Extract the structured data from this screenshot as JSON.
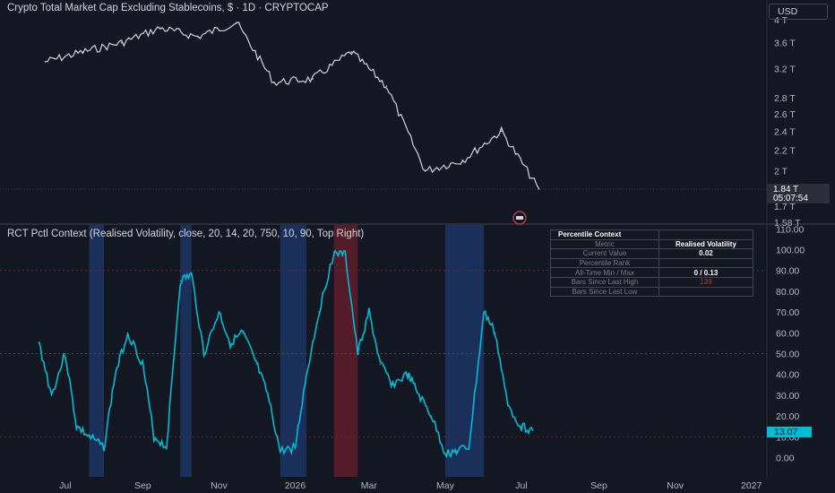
{
  "main_chart": {
    "title": "Crypto Total Market Cap Excluding Stablecoins, $ · 1D · CRYPTOCAP",
    "currency_button": "USD",
    "price_axis": [
      "4 T",
      "3.6 T",
      "3.2 T",
      "2.8 T",
      "2.6 T",
      "2.4 T",
      "2.2 T",
      "2 T",
      "1.7 T",
      "1.58 T"
    ],
    "last_price": "1.84 T",
    "countdown": "05:07:54"
  },
  "indicator": {
    "title": "RCT Pctl Context (Realised Volatility, close, 20, 14, 20, 750, 10, 90, Top Right)",
    "current_label": "13.07",
    "colors": {
      "line": "#00bcd4",
      "low_band": "#1e3a6e",
      "high_band": "#6b1f2b"
    }
  },
  "context_table": {
    "header": "Percentile Context",
    "rows": [
      {
        "label": "Metric",
        "value": "Realised Volatility"
      },
      {
        "label": "Current Value",
        "value": "0.02"
      },
      {
        "label": "Percentile Rank",
        "value": ""
      },
      {
        "label": "All-Time Min / Max",
        "value": "0 / 0.13"
      },
      {
        "label": "Bars Since Last High",
        "value": "139"
      },
      {
        "label": "Bars Since Last Low",
        "value": ""
      }
    ]
  },
  "time_axis": [
    "Jul",
    "Sep",
    "Nov",
    "2026",
    "Mar",
    "May",
    "Jul",
    "Sep",
    "Nov",
    "2027"
  ],
  "chart_data": [
    {
      "type": "line",
      "x": [
        "2025-06",
        "2025-07",
        "2025-08",
        "2025-09",
        "2025-10",
        "2025-11",
        "2025-12",
        "2026-01",
        "2026-02",
        "2026-03",
        "2026-04",
        "2026-05",
        "2026-06",
        "2026-07"
      ],
      "series": [
        {
          "values": [
            3.3,
            3.45,
            3.6,
            3.85,
            3.7,
            3.95,
            3.0,
            3.05,
            3.45,
            2.95,
            2.0,
            2.1,
            2.4,
            1.84
          ]
        }
      ],
      "y_ticks": [
        "4 T",
        "3.6 T",
        "3.2 T",
        "2.8 T",
        "2.6 T",
        "2.4 T",
        "2.2 T",
        "2 T",
        "1.7 T",
        "1.58 T"
      ],
      "ylim": [
        1.58,
        4.1
      ],
      "yscale": "log"
    },
    {
      "type": "line",
      "x": [
        "2025-06-10",
        "2025-06-20",
        "2025-07-01",
        "2025-07-10",
        "2025-07-20",
        "2025-08-01",
        "2025-08-10",
        "2025-08-20",
        "2025-09-01",
        "2025-09-10",
        "2025-09-20",
        "2025-10-01",
        "2025-10-10",
        "2025-10-20",
        "2025-11-01",
        "2025-11-10",
        "2025-11-20",
        "2025-12-01",
        "2025-12-10",
        "2025-12-20",
        "2026-01-01",
        "2026-01-10",
        "2026-01-20",
        "2026-02-01",
        "2026-02-10",
        "2026-02-20",
        "2026-03-01",
        "2026-03-10",
        "2026-03-20",
        "2026-04-01",
        "2026-04-10",
        "2026-04-20",
        "2026-05-01",
        "2026-05-10",
        "2026-05-20",
        "2026-06-01",
        "2026-06-10",
        "2026-06-20",
        "2026-07-01",
        "2026-07-10"
      ],
      "series": [
        {
          "values": [
            55,
            30,
            50,
            15,
            10,
            5,
            40,
            60,
            45,
            10,
            5,
            85,
            88,
            50,
            70,
            55,
            60,
            45,
            30,
            3,
            5,
            40,
            70,
            99,
            98,
            50,
            70,
            45,
            35,
            40,
            30,
            20,
            2,
            3,
            5,
            70,
            60,
            25,
            15,
            13.07
          ]
        }
      ],
      "y_ticks": [
        "0.00",
        "10.00",
        "20.00",
        "30.00",
        "40.00",
        "50.00",
        "60.00",
        "70.00",
        "80.00",
        "90.00",
        "100.00",
        "110.00"
      ],
      "ylim": [
        -5,
        110
      ],
      "reference_lines": [
        10,
        50,
        90
      ]
    }
  ]
}
